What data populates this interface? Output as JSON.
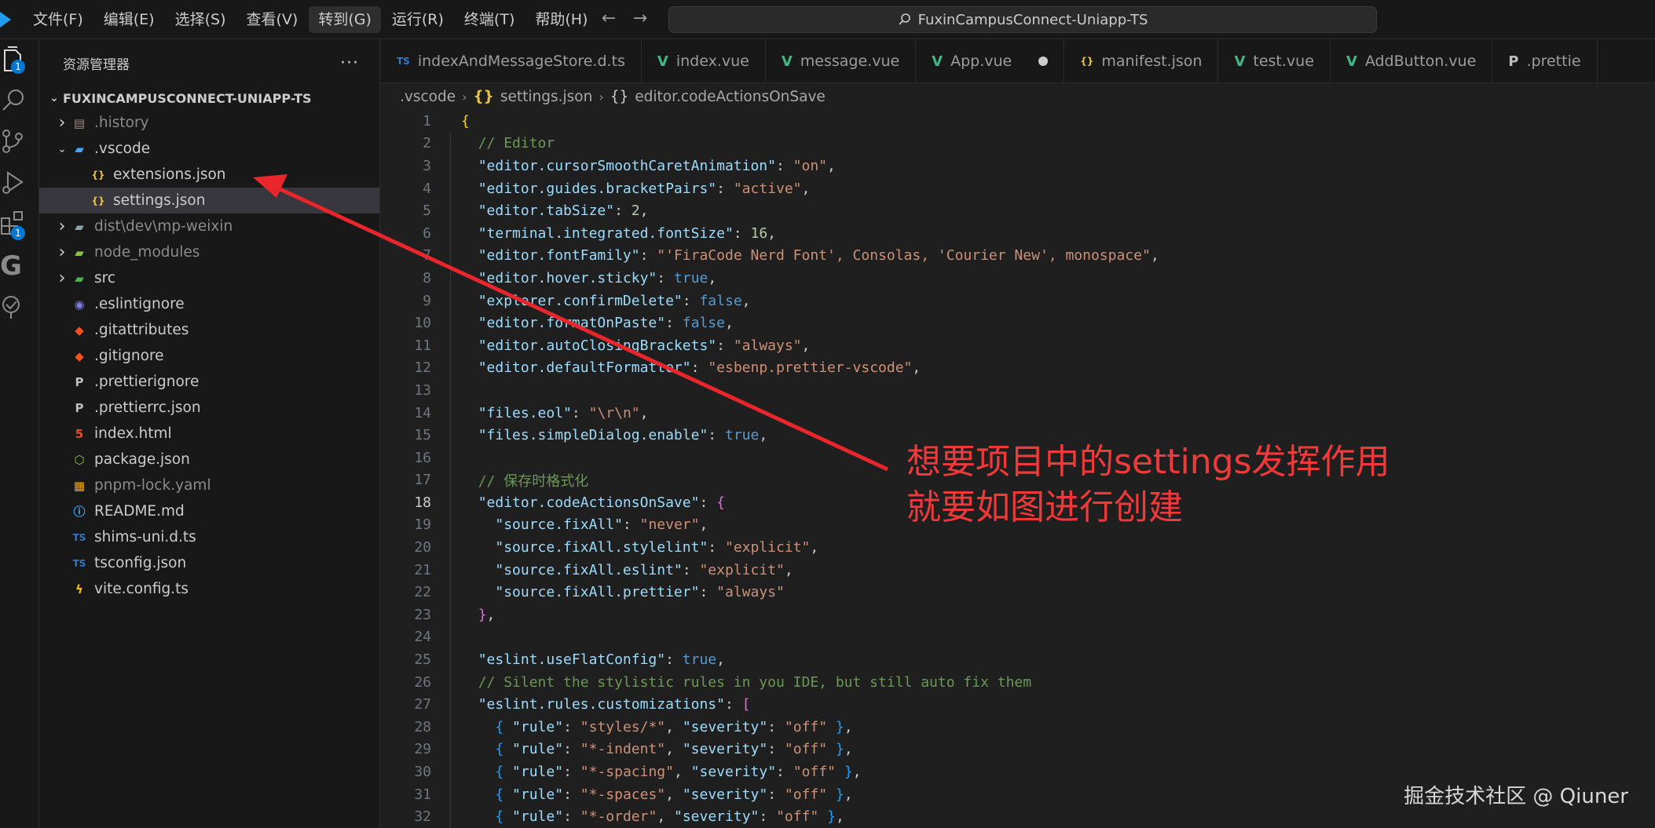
{
  "menu": [
    "文件(F)",
    "编辑(E)",
    "选择(S)",
    "查看(V)",
    "转到(G)",
    "运行(R)",
    "终端(T)",
    "帮助(H)"
  ],
  "command_center": {
    "text": "FuxinCampusConnect-Uniapp-TS"
  },
  "activity": {
    "explorer_badge": "1",
    "extensions_badge": "1"
  },
  "sidebar": {
    "title": "资源管理器",
    "more": "···",
    "root": "FUXINCAMPUSCONNECT-UNIAPP-TS",
    "items": [
      {
        "label": ".history",
        "depth": 0,
        "chevron": "right",
        "icon": "history-folder-icon",
        "dim": true
      },
      {
        "label": ".vscode",
        "depth": 0,
        "chevron": "down",
        "icon": "vscode-folder-icon",
        "dim": false
      },
      {
        "label": "extensions.json",
        "depth": 1,
        "chevron": "",
        "icon": "json-icon",
        "dim": false
      },
      {
        "label": "settings.json",
        "depth": 1,
        "chevron": "",
        "icon": "json-icon",
        "dim": false,
        "selected": true
      },
      {
        "label": "dist\\dev\\mp-weixin",
        "depth": 0,
        "chevron": "right",
        "icon": "folder-icon",
        "dim": true
      },
      {
        "label": "node_modules",
        "depth": 0,
        "chevron": "right",
        "icon": "node-folder-icon",
        "dim": true
      },
      {
        "label": "src",
        "depth": 0,
        "chevron": "right",
        "icon": "src-folder-icon",
        "dim": false
      },
      {
        "label": ".eslintignore",
        "depth": 0,
        "chevron": "",
        "icon": "eslint-icon",
        "dim": false
      },
      {
        "label": ".gitattributes",
        "depth": 0,
        "chevron": "",
        "icon": "git-icon",
        "dim": false
      },
      {
        "label": ".gitignore",
        "depth": 0,
        "chevron": "",
        "icon": "git-icon",
        "dim": false
      },
      {
        "label": ".prettierignore",
        "depth": 0,
        "chevron": "",
        "icon": "prettier-icon",
        "dim": false
      },
      {
        "label": ".prettierrc.json",
        "depth": 0,
        "chevron": "",
        "icon": "prettier-icon",
        "dim": false
      },
      {
        "label": "index.html",
        "depth": 0,
        "chevron": "",
        "icon": "html-icon",
        "dim": false
      },
      {
        "label": "package.json",
        "depth": 0,
        "chevron": "",
        "icon": "nodejs-icon",
        "dim": false
      },
      {
        "label": "pnpm-lock.yaml",
        "depth": 0,
        "chevron": "",
        "icon": "pnpm-icon",
        "dim": true
      },
      {
        "label": "README.md",
        "depth": 0,
        "chevron": "",
        "icon": "info-icon",
        "dim": false
      },
      {
        "label": "shims-uni.d.ts",
        "depth": 0,
        "chevron": "",
        "icon": "typescript-def-icon",
        "dim": false
      },
      {
        "label": "tsconfig.json",
        "depth": 0,
        "chevron": "",
        "icon": "tsconfig-icon",
        "dim": false
      },
      {
        "label": "vite.config.ts",
        "depth": 0,
        "chevron": "",
        "icon": "vite-icon",
        "dim": false
      }
    ]
  },
  "tabs": [
    {
      "label": "indexAndMessageStore.d.ts",
      "icon": "typescript-def-icon"
    },
    {
      "label": "index.vue",
      "icon": "vue-icon"
    },
    {
      "label": "message.vue",
      "icon": "vue-icon"
    },
    {
      "label": "App.vue",
      "icon": "vue-icon",
      "dirty": true
    },
    {
      "label": "manifest.json",
      "icon": "json-icon"
    },
    {
      "label": "test.vue",
      "icon": "vue-icon"
    },
    {
      "label": "AddButton.vue",
      "icon": "vue-icon"
    },
    {
      "label": ".prettie",
      "icon": "prettier-icon"
    }
  ],
  "breadcrumb": {
    "folder": ".vscode",
    "file": "settings.json",
    "symbol": "editor.codeActionsOnSave"
  },
  "editor": {
    "current_line": 18,
    "lines": [
      [
        [
          "{",
          "br1"
        ]
      ],
      [
        [
          "  ",
          ""
        ],
        [
          "// Editor",
          "com"
        ]
      ],
      [
        [
          "  ",
          ""
        ],
        [
          "\"editor.cursorSmoothCaretAnimation\"",
          "key"
        ],
        [
          ": ",
          "pun"
        ],
        [
          "\"on\"",
          "str"
        ],
        [
          ",",
          "pun"
        ]
      ],
      [
        [
          "  ",
          ""
        ],
        [
          "\"editor.guides.bracketPairs\"",
          "key"
        ],
        [
          ": ",
          "pun"
        ],
        [
          "\"active\"",
          "str"
        ],
        [
          ",",
          "pun"
        ]
      ],
      [
        [
          "  ",
          ""
        ],
        [
          "\"editor.tabSize\"",
          "key"
        ],
        [
          ": ",
          "pun"
        ],
        [
          "2",
          "num"
        ],
        [
          ",",
          "pun"
        ]
      ],
      [
        [
          "  ",
          ""
        ],
        [
          "\"terminal.integrated.fontSize\"",
          "key"
        ],
        [
          ": ",
          "pun"
        ],
        [
          "16",
          "num"
        ],
        [
          ",",
          "pun"
        ]
      ],
      [
        [
          "  ",
          ""
        ],
        [
          "\"editor.fontFamily\"",
          "key"
        ],
        [
          ": ",
          "pun"
        ],
        [
          "\"'FiraCode Nerd Font', Consolas, 'Courier New', monospace\"",
          "str"
        ],
        [
          ",",
          "pun"
        ]
      ],
      [
        [
          "  ",
          ""
        ],
        [
          "\"editor.hover.sticky\"",
          "key"
        ],
        [
          ": ",
          "pun"
        ],
        [
          "true",
          "bool"
        ],
        [
          ",",
          "pun"
        ]
      ],
      [
        [
          "  ",
          ""
        ],
        [
          "\"explorer.confirmDelete\"",
          "key"
        ],
        [
          ": ",
          "pun"
        ],
        [
          "false",
          "bool"
        ],
        [
          ",",
          "pun"
        ]
      ],
      [
        [
          "  ",
          ""
        ],
        [
          "\"editor.formatOnPaste\"",
          "key"
        ],
        [
          ": ",
          "pun"
        ],
        [
          "false",
          "bool"
        ],
        [
          ",",
          "pun"
        ]
      ],
      [
        [
          "  ",
          ""
        ],
        [
          "\"editor.autoClosingBrackets\"",
          "key"
        ],
        [
          ": ",
          "pun"
        ],
        [
          "\"always\"",
          "str"
        ],
        [
          ",",
          "pun"
        ]
      ],
      [
        [
          "  ",
          ""
        ],
        [
          "\"editor.defaultFormatter\"",
          "key"
        ],
        [
          ": ",
          "pun"
        ],
        [
          "\"esbenp.prettier-vscode\"",
          "str"
        ],
        [
          ",",
          "pun"
        ]
      ],
      [
        [
          "",
          ""
        ]
      ],
      [
        [
          "  ",
          ""
        ],
        [
          "\"files.eol\"",
          "key"
        ],
        [
          ": ",
          "pun"
        ],
        [
          "\"\\r\\n\"",
          "str"
        ],
        [
          ",",
          "pun"
        ]
      ],
      [
        [
          "  ",
          ""
        ],
        [
          "\"files.simpleDialog.enable\"",
          "key"
        ],
        [
          ": ",
          "pun"
        ],
        [
          "true",
          "bool"
        ],
        [
          ",",
          "pun"
        ]
      ],
      [
        [
          "",
          ""
        ]
      ],
      [
        [
          "  ",
          ""
        ],
        [
          "// 保存时格式化",
          "com"
        ]
      ],
      [
        [
          "  ",
          ""
        ],
        [
          "\"editor.codeActionsOnSave\"",
          "key"
        ],
        [
          ": ",
          "pun"
        ],
        [
          "{",
          "br2"
        ]
      ],
      [
        [
          "    ",
          ""
        ],
        [
          "\"source.fixAll\"",
          "key"
        ],
        [
          ": ",
          "pun"
        ],
        [
          "\"never\"",
          "str"
        ],
        [
          ",",
          "pun"
        ]
      ],
      [
        [
          "    ",
          ""
        ],
        [
          "\"source.fixAll.stylelint\"",
          "key"
        ],
        [
          ": ",
          "pun"
        ],
        [
          "\"explicit\"",
          "str"
        ],
        [
          ",",
          "pun"
        ]
      ],
      [
        [
          "    ",
          ""
        ],
        [
          "\"source.fixAll.eslint\"",
          "key"
        ],
        [
          ": ",
          "pun"
        ],
        [
          "\"explicit\"",
          "str"
        ],
        [
          ",",
          "pun"
        ]
      ],
      [
        [
          "    ",
          ""
        ],
        [
          "\"source.fixAll.prettier\"",
          "key"
        ],
        [
          ": ",
          "pun"
        ],
        [
          "\"always\"",
          "str"
        ]
      ],
      [
        [
          "  ",
          ""
        ],
        [
          "}",
          "br2"
        ],
        [
          ",",
          "pun"
        ]
      ],
      [
        [
          "",
          ""
        ]
      ],
      [
        [
          "  ",
          ""
        ],
        [
          "\"eslint.useFlatConfig\"",
          "key"
        ],
        [
          ": ",
          "pun"
        ],
        [
          "true",
          "bool"
        ],
        [
          ",",
          "pun"
        ]
      ],
      [
        [
          "  ",
          ""
        ],
        [
          "// Silent the stylistic rules in you IDE, but still auto fix them",
          "com"
        ]
      ],
      [
        [
          "  ",
          ""
        ],
        [
          "\"eslint.rules.customizations\"",
          "key"
        ],
        [
          ": ",
          "pun"
        ],
        [
          "[",
          "br2"
        ]
      ],
      [
        [
          "    ",
          ""
        ],
        [
          "{ ",
          "br3"
        ],
        [
          "\"rule\"",
          "key"
        ],
        [
          ": ",
          "pun"
        ],
        [
          "\"styles/*\"",
          "str"
        ],
        [
          ", ",
          "pun"
        ],
        [
          "\"severity\"",
          "key"
        ],
        [
          ": ",
          "pun"
        ],
        [
          "\"off\"",
          "str"
        ],
        [
          " }",
          "br3"
        ],
        [
          ",",
          "pun"
        ]
      ],
      [
        [
          "    ",
          ""
        ],
        [
          "{ ",
          "br3"
        ],
        [
          "\"rule\"",
          "key"
        ],
        [
          ": ",
          "pun"
        ],
        [
          "\"*-indent\"",
          "str"
        ],
        [
          ", ",
          "pun"
        ],
        [
          "\"severity\"",
          "key"
        ],
        [
          ": ",
          "pun"
        ],
        [
          "\"off\"",
          "str"
        ],
        [
          " }",
          "br3"
        ],
        [
          ",",
          "pun"
        ]
      ],
      [
        [
          "    ",
          ""
        ],
        [
          "{ ",
          "br3"
        ],
        [
          "\"rule\"",
          "key"
        ],
        [
          ": ",
          "pun"
        ],
        [
          "\"*-spacing\"",
          "str"
        ],
        [
          ", ",
          "pun"
        ],
        [
          "\"severity\"",
          "key"
        ],
        [
          ": ",
          "pun"
        ],
        [
          "\"off\"",
          "str"
        ],
        [
          " }",
          "br3"
        ],
        [
          ",",
          "pun"
        ]
      ],
      [
        [
          "    ",
          ""
        ],
        [
          "{ ",
          "br3"
        ],
        [
          "\"rule\"",
          "key"
        ],
        [
          ": ",
          "pun"
        ],
        [
          "\"*-spaces\"",
          "str"
        ],
        [
          ", ",
          "pun"
        ],
        [
          "\"severity\"",
          "key"
        ],
        [
          ": ",
          "pun"
        ],
        [
          "\"off\"",
          "str"
        ],
        [
          " }",
          "br3"
        ],
        [
          ",",
          "pun"
        ]
      ],
      [
        [
          "    ",
          ""
        ],
        [
          "{ ",
          "br3"
        ],
        [
          "\"rule\"",
          "key"
        ],
        [
          ": ",
          "pun"
        ],
        [
          "\"*-order\"",
          "str"
        ],
        [
          ", ",
          "pun"
        ],
        [
          "\"severity\"",
          "key"
        ],
        [
          ": ",
          "pun"
        ],
        [
          "\"off\"",
          "str"
        ],
        [
          " }",
          "br3"
        ],
        [
          ",",
          "pun"
        ]
      ]
    ]
  },
  "annotation": {
    "line1": "想要项目中的settings发挥作用",
    "line2": "就要如图进行创建",
    "color": "#f03a3a"
  },
  "watermark": "掘金技术社区 @ Qiuner"
}
